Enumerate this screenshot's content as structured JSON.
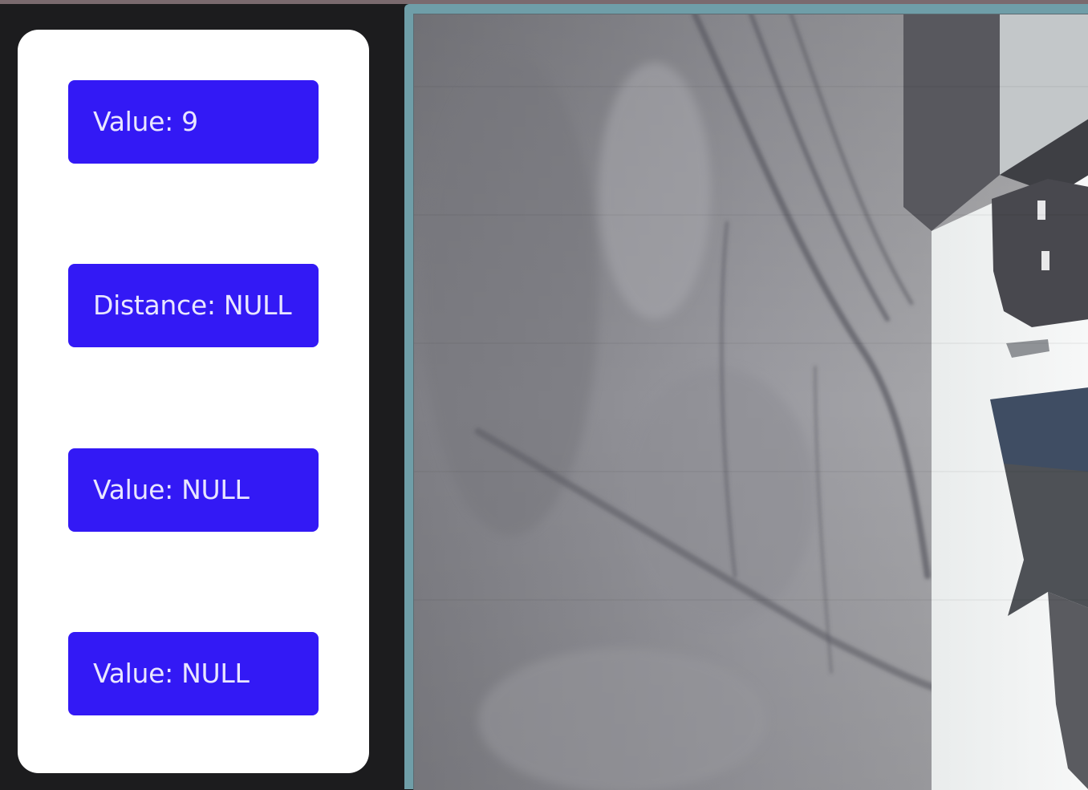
{
  "readouts": [
    {
      "label": "Value: 9"
    },
    {
      "label": "Distance: NULL"
    },
    {
      "label": "Value: NULL"
    },
    {
      "label": "Value: NULL"
    }
  ],
  "colors": {
    "background": "#1c1c1e",
    "card": "#ffffff",
    "readout_bg": "#3319f5",
    "readout_text": "#e9e6ff",
    "feed_border": "#6f9ea8"
  },
  "camera_feed": {
    "content": "live-camera-image"
  }
}
